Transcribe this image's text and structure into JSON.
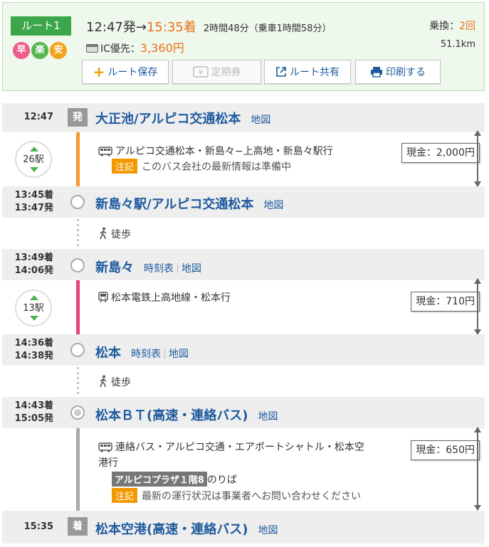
{
  "header": {
    "route_label": "ルート1",
    "tags": [
      "早",
      "楽",
      "安"
    ],
    "depart": "12:47発",
    "arrow": "→",
    "arrive": "15:35着",
    "duration": "2時間48分（乗車1時間58分）",
    "fare_prefix": "IC優先：",
    "fare": "3,360円",
    "transfer_label": "乗換：",
    "transfer_count": "2回",
    "distance": "51.1km"
  },
  "buttons": {
    "save": "ルート保存",
    "pass": "定期券",
    "share": "ルート共有",
    "print": "印刷する"
  },
  "colors": {
    "bus_line": "#f39c33",
    "rail_line": "#e8417d",
    "bus2_line": "#aaaaaa",
    "accent": "#ee6f1a",
    "link": "#1e5a9e"
  },
  "stations": [
    {
      "time": "12:47",
      "badge": "発",
      "name": "大正池/アルピコ交通松本",
      "links": [
        "地図"
      ]
    },
    {
      "time_arr": "13:45着",
      "time_dep": "13:47発",
      "name": "新島々駅/アルピコ交通松本",
      "links": [
        "地図"
      ]
    },
    {
      "time_arr": "13:49着",
      "time_dep": "14:06発",
      "name": "新島々",
      "links": [
        "時刻表",
        "地図"
      ]
    },
    {
      "time_arr": "14:36着",
      "time_dep": "14:38発",
      "name": "松本",
      "links": [
        "時刻表",
        "地図"
      ]
    },
    {
      "time_arr": "14:43着",
      "time_dep": "15:05発",
      "name": "松本ＢＴ(高速・連絡バス)",
      "links": [
        "地図"
      ]
    },
    {
      "time": "15:35",
      "badge": "着",
      "name": "松本空港(高速・連絡バス)",
      "links": [
        "地図"
      ]
    }
  ],
  "segments": [
    {
      "stops": "26駅",
      "line": "アルピコ交通松本・新島々−上高地・新島々駅行",
      "note_chip": "注記",
      "note": "このバス会社の最新情報は準備中",
      "fare": "現金：2,000円"
    },
    {
      "walk": "徒歩"
    },
    {
      "stops": "13駅",
      "line": "松本電鉄上高地線・松本行",
      "fare": "現金：710円"
    },
    {
      "walk": "徒歩"
    },
    {
      "line_1": "連絡バス・アルピコ交通・エアポートシャトル・松本空",
      "line_2": "港行",
      "platform_chip": "アルピコプラザ１階8",
      "platform_suffix": "のりば",
      "note_chip": "注記",
      "note": "最新の運行状況は事業者へお問い合わせください",
      "fare": "現金：650円"
    }
  ]
}
